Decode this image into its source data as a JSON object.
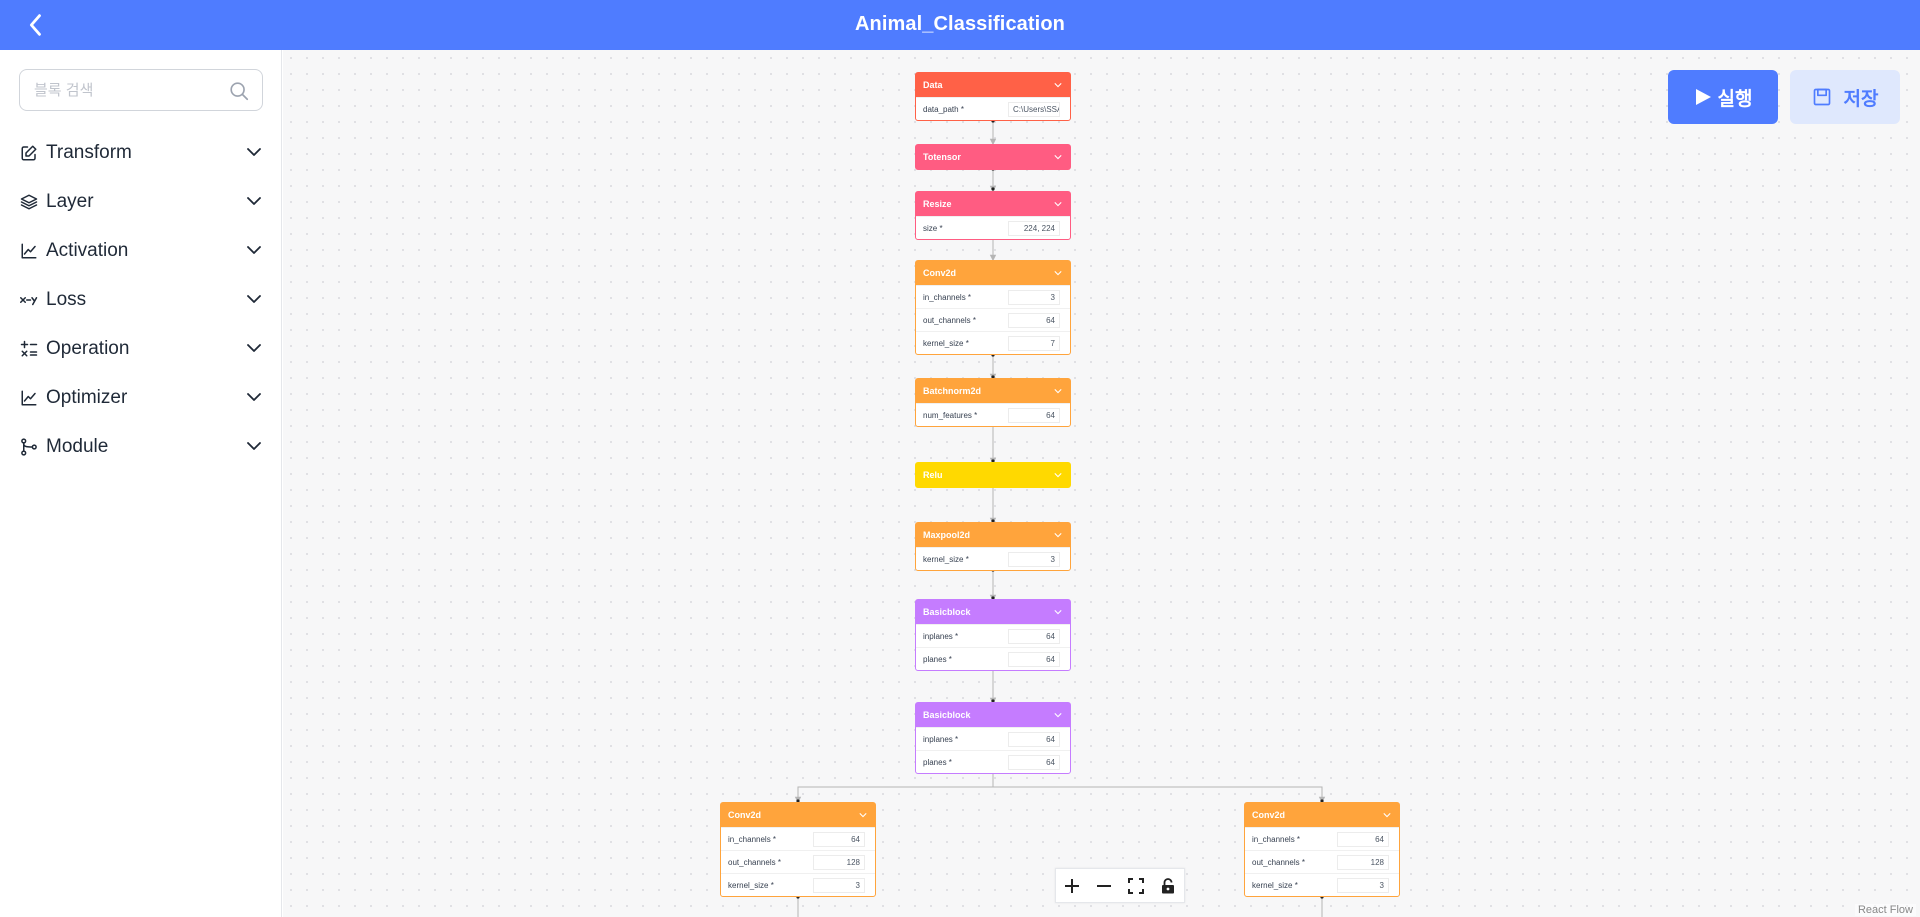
{
  "header": {
    "title": "Animal_Classification",
    "back_icon": "chevron-left-icon"
  },
  "sidebar": {
    "search": {
      "placeholder": "블록 검색",
      "value": ""
    },
    "items": [
      {
        "label": "Transform",
        "icon": "edit-icon"
      },
      {
        "label": "Layer",
        "icon": "layers-icon"
      },
      {
        "label": "Activation",
        "icon": "line-chart-icon"
      },
      {
        "label": "Loss",
        "icon": "x-minus-y-icon"
      },
      {
        "label": "Operation",
        "icon": "calculator-icon"
      },
      {
        "label": "Optimizer",
        "icon": "line-chart-icon"
      },
      {
        "label": "Module",
        "icon": "graph-nodes-icon"
      }
    ]
  },
  "actions": {
    "run_label": "실행",
    "save_label": "저장"
  },
  "colors": {
    "header": "#4f7cff",
    "data": "#ff6147",
    "transform": "#ff5c82",
    "layer": "#ffa43c",
    "activation": "#ffd900",
    "module": "#c57cff"
  },
  "nodes": [
    {
      "title": "Data",
      "params": [
        {
          "label": "data_path *",
          "value": "C:\\Users\\SSA"
        }
      ]
    },
    {
      "title": "Totensor",
      "params": []
    },
    {
      "title": "Resize",
      "params": [
        {
          "label": "size *",
          "value": "224, 224"
        }
      ]
    },
    {
      "title": "Conv2d",
      "params": [
        {
          "label": "in_channels *",
          "value": "3"
        },
        {
          "label": "out_channels *",
          "value": "64"
        },
        {
          "label": "kernel_size *",
          "value": "7"
        }
      ]
    },
    {
      "title": "Batchnorm2d",
      "params": [
        {
          "label": "num_features *",
          "value": "64"
        }
      ]
    },
    {
      "title": "Relu",
      "params": []
    },
    {
      "title": "Maxpool2d",
      "params": [
        {
          "label": "kernel_size *",
          "value": "3"
        }
      ]
    },
    {
      "title": "Basicblock",
      "params": [
        {
          "label": "inplanes *",
          "value": "64"
        },
        {
          "label": "planes *",
          "value": "64"
        }
      ]
    },
    {
      "title": "Basicblock",
      "params": [
        {
          "label": "inplanes *",
          "value": "64"
        },
        {
          "label": "planes *",
          "value": "64"
        }
      ]
    },
    {
      "title": "Conv2d",
      "params": [
        {
          "label": "in_channels *",
          "value": "64"
        },
        {
          "label": "out_channels *",
          "value": "128"
        },
        {
          "label": "kernel_size *",
          "value": "3"
        }
      ]
    },
    {
      "title": "Conv2d",
      "params": [
        {
          "label": "in_channels *",
          "value": "64"
        },
        {
          "label": "out_channels *",
          "value": "128"
        },
        {
          "label": "kernel_size *",
          "value": "3"
        }
      ]
    }
  ],
  "controls": {
    "zoom_in": "plus-icon",
    "zoom_out": "minus-icon",
    "fit": "fit-view-icon",
    "lock": "lock-icon"
  },
  "attribution": "React Flow"
}
